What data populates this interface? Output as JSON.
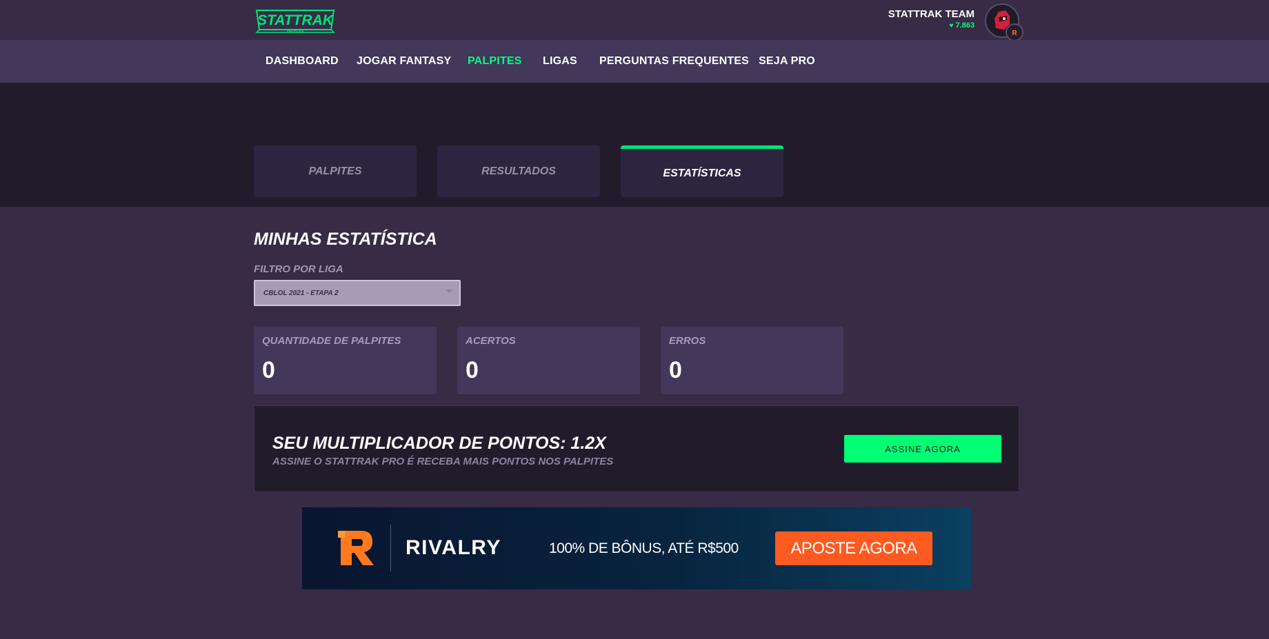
{
  "header": {
    "logo_text": "STATTRAK",
    "logo_subtext": "PALPITES",
    "user_name": "STATTRAK TEAM",
    "user_points": "7.863"
  },
  "nav": {
    "items": [
      {
        "label": "DASHBOARD"
      },
      {
        "label": "JOGAR FANTASY"
      },
      {
        "label": "PALPITES"
      },
      {
        "label": "LIGAS"
      },
      {
        "label": "PERGUNTAS FREQUENTES"
      },
      {
        "label": "SEJA PRO"
      }
    ],
    "active": "PALPITES"
  },
  "tabs": [
    {
      "label": "PALPITES"
    },
    {
      "label": "RESULTADOS"
    },
    {
      "label": "ESTATÍSTICAS"
    }
  ],
  "main": {
    "title": "MINHAS ESTATÍSTICA",
    "filter_label": "FILTRO POR LIGA",
    "filter_value": "CBLOL 2021 - ETAPA 2",
    "stats": [
      {
        "label": "QUANTIDADE DE PALPITES",
        "value": "0"
      },
      {
        "label": "ACERTOS",
        "value": "0"
      },
      {
        "label": "ERROS",
        "value": "0"
      }
    ]
  },
  "promo": {
    "title": "SEU MULTIPLICADOR DE PONTOS: 1.2X",
    "subtitle": "ASSINE O STATTRAK PRO É RECEBA MAIS PONTOS NOS PALPITES",
    "button_label": "ASSINE AGORA"
  },
  "ad": {
    "brand": "RIVALRY",
    "text": "100% DE BÔNUS, ATÉ R$500",
    "button_label": "APOSTE AGORA"
  },
  "colors": {
    "accent": "#00ff7a",
    "background": "#372b45",
    "hero": "#221b2c",
    "ad_button": "#ff5a1f"
  }
}
